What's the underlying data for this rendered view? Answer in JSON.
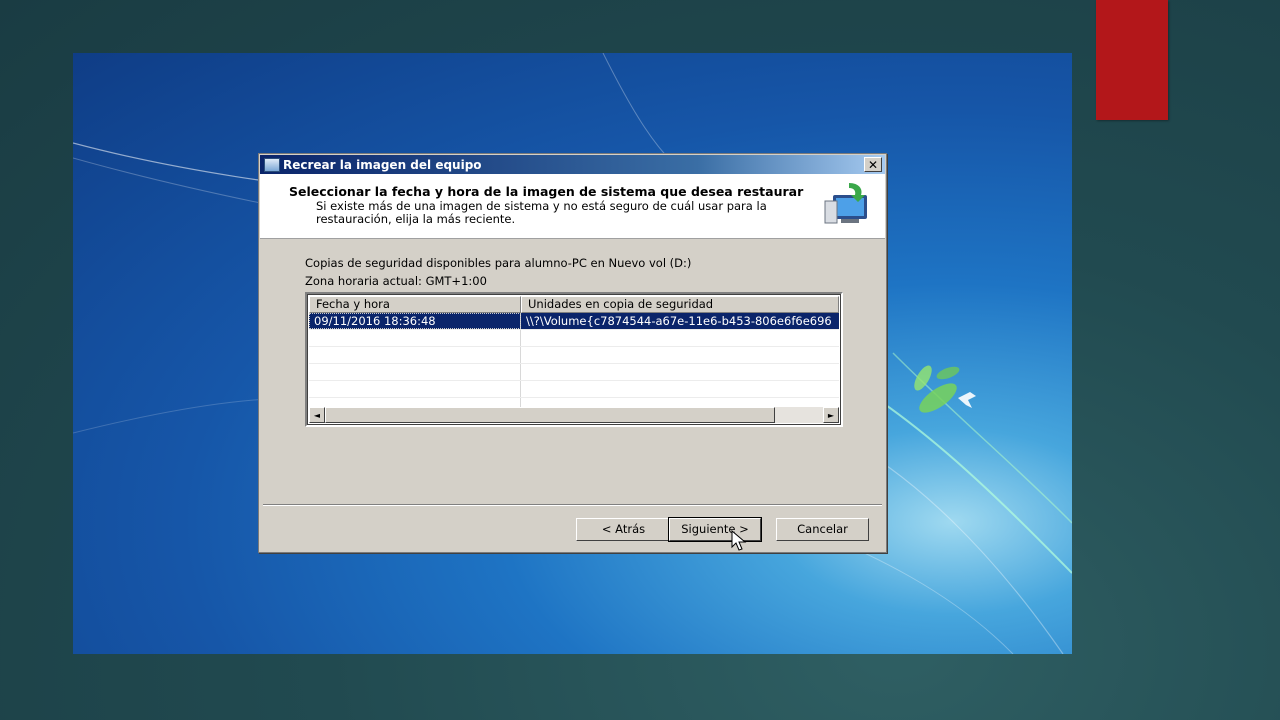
{
  "window": {
    "title": "Recrear la imagen del equipo",
    "close_label": "✕"
  },
  "header": {
    "heading": "Seleccionar la fecha y hora de la imagen de sistema que desea restaurar",
    "description": "Si existe más de una imagen de sistema y no está seguro de cuál usar para la restauración, elija la más reciente."
  },
  "info": {
    "available_backups": "Copias de seguridad disponibles para alumno-PC en Nuevo vol (D:)",
    "timezone": "Zona horaria actual: GMT+1:00"
  },
  "table": {
    "columns": [
      "Fecha y hora",
      "Unidades en copia de seguridad"
    ],
    "rows": [
      {
        "date": "09/11/2016 18:36:48",
        "units": "\\\\?\\Volume{c7874544-a67e-11e6-b453-806e6f6e696"
      }
    ]
  },
  "buttons": {
    "back": "< Atrás",
    "next": "Siguiente >",
    "cancel": "Cancelar"
  },
  "icons": {
    "scroll_left": "◄",
    "scroll_right": "►"
  },
  "colors": {
    "accent_red": "#b3171a",
    "selection": "#0a246a"
  }
}
